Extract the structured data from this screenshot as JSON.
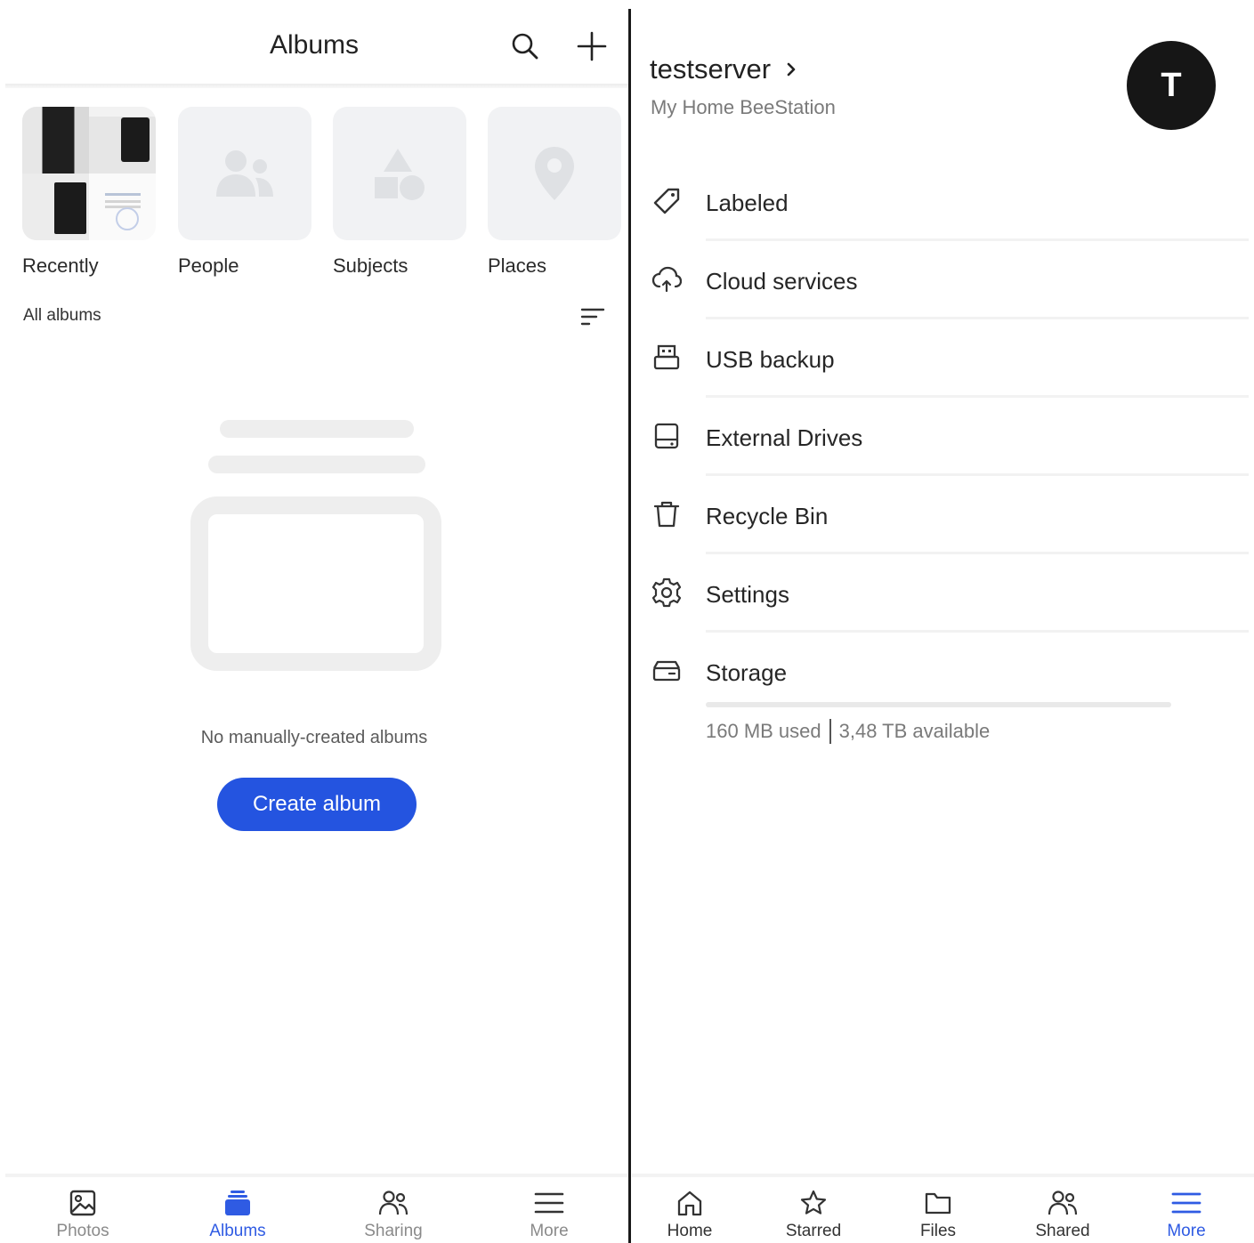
{
  "left": {
    "header": {
      "title": "Albums"
    },
    "tiles": [
      {
        "label": "Recently"
      },
      {
        "label": "People"
      },
      {
        "label": "Subjects"
      },
      {
        "label": "Places"
      }
    ],
    "all_albums_label": "All albums",
    "empty_text": "No manually-created albums",
    "create_button": "Create album",
    "bottom_nav": [
      {
        "label": "Photos",
        "icon": "photo-icon",
        "active": false
      },
      {
        "label": "Albums",
        "icon": "albums-icon",
        "active": true
      },
      {
        "label": "Sharing",
        "icon": "people-icon",
        "active": false
      },
      {
        "label": "More",
        "icon": "menu-icon",
        "active": false
      }
    ]
  },
  "right": {
    "server": {
      "name": "testserver",
      "subtitle": "My Home BeeStation",
      "avatar_letter": "T"
    },
    "menu": [
      {
        "label": "Labeled",
        "icon": "tag-icon"
      },
      {
        "label": "Cloud services",
        "icon": "cloud-sync-icon"
      },
      {
        "label": "USB backup",
        "icon": "usb-icon"
      },
      {
        "label": "External Drives",
        "icon": "drive-icon"
      },
      {
        "label": "Recycle Bin",
        "icon": "trash-icon"
      },
      {
        "label": "Settings",
        "icon": "gear-icon"
      },
      {
        "label": "Storage",
        "icon": "storage-icon"
      }
    ],
    "storage": {
      "used": "160 MB used",
      "available": "3,48 TB available",
      "used_fraction": 0.0
    },
    "bottom_nav": [
      {
        "label": "Home",
        "icon": "home-icon",
        "active": false
      },
      {
        "label": "Starred",
        "icon": "star-icon",
        "active": false
      },
      {
        "label": "Files",
        "icon": "folder-icon",
        "active": false
      },
      {
        "label": "Shared",
        "icon": "people-icon",
        "active": false
      },
      {
        "label": "More",
        "icon": "menu-icon",
        "active": true
      }
    ]
  },
  "colors": {
    "accent": "#2f5be3",
    "button": "#2454e0",
    "avatar": "#161616"
  }
}
